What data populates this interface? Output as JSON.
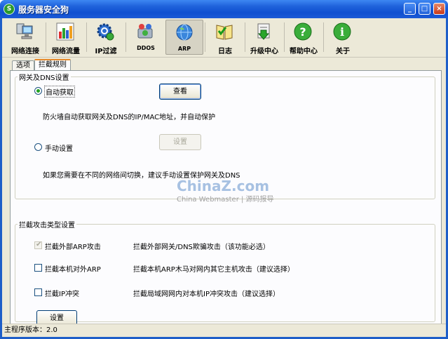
{
  "window": {
    "title": "服务器安全狗",
    "app_icon_glyph": "S",
    "controls": {
      "minimize": "_",
      "maximize": "□",
      "close": "×"
    }
  },
  "toolbar": {
    "items": [
      {
        "label": "网络连接",
        "icon": "network-computer-icon"
      },
      {
        "label": "网络流量",
        "icon": "bar-chart-icon"
      },
      {
        "label": "IP过滤",
        "icon": "gear-filter-icon"
      },
      {
        "label": "DDOS",
        "icon": "ddos-shield-icon"
      },
      {
        "label": "ARP",
        "icon": "globe-icon",
        "active": true
      },
      {
        "label": "日志",
        "icon": "log-book-icon"
      },
      {
        "label": "升级中心",
        "icon": "download-update-icon"
      },
      {
        "label": "帮助中心",
        "icon": "help-question-icon"
      },
      {
        "label": "关于",
        "icon": "info-icon"
      }
    ]
  },
  "tabs": [
    {
      "label": "选项",
      "selected": false
    },
    {
      "label": "拦截规则",
      "selected": true
    }
  ],
  "gateway_group": {
    "title": "网关及DNS设置",
    "auto_radio": {
      "label": "自动获取",
      "selected": true
    },
    "view_button": "查看",
    "auto_desc": "防火墙自动获取网关及DNS的IP/MAC地址，并自动保护",
    "manual_radio": {
      "label": "手动设置",
      "selected": false
    },
    "set_button": "设置",
    "manual_desc": "如果您需要在不同的网络间切换，建议手动设置保护网关及DNS"
  },
  "attack_group": {
    "title": "拦截攻击类型设置",
    "rows": [
      {
        "label": "拦截外部ARP攻击",
        "desc": "拦截外部网关/DNS欺骗攻击（该功能必选）",
        "checked": true,
        "disabled": true
      },
      {
        "label": "拦截本机对外ARP",
        "desc": "拦截本机ARP木马对网内其它主机攻击（建议选择）",
        "checked": false,
        "disabled": false
      },
      {
        "label": "拦截IP冲突",
        "desc": "拦截局域网网内对本机IP冲突攻击（建议选择）",
        "checked": false,
        "disabled": false
      }
    ],
    "set_button": "设置"
  },
  "watermark": {
    "main": "ChinaZ.com",
    "sub": "China Webmaster | 源码报导"
  },
  "status": {
    "version_text": "主程序版本：2.0"
  },
  "colors": {
    "titlebar": "#0f4fd0",
    "accent_tab": "#e68b2c",
    "face": "#ece9d8"
  }
}
